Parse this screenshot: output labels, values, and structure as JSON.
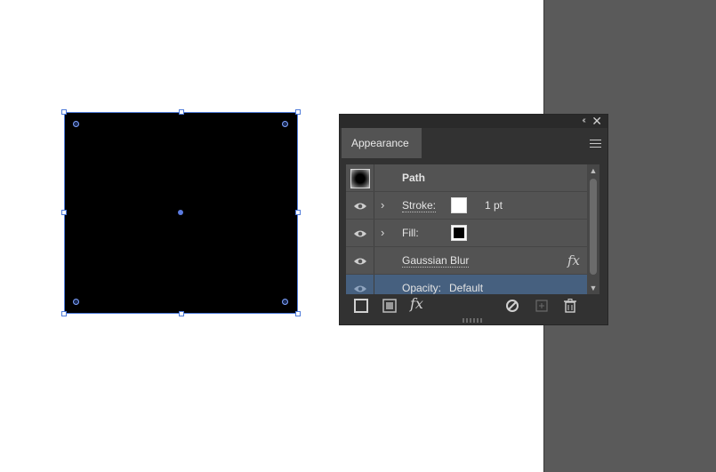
{
  "panel": {
    "tab_label": "Appearance",
    "collapse_glyph": "‹‹",
    "close_glyph": "✕"
  },
  "rows": [
    {
      "label": "Path"
    },
    {
      "label": "Stroke:",
      "value": "1 pt"
    },
    {
      "label": "Fill:"
    },
    {
      "label": "Gaussian Blur",
      "fx": "fx"
    },
    {
      "label": "Opacity:",
      "value": "Default"
    }
  ],
  "footer": {
    "add_effect": "fx"
  },
  "colors": {
    "selection": "#4f7bd9",
    "panel_bg": "#323232",
    "row_bg": "#535353",
    "selected_row": "#46607f",
    "pasteboard": "#5a5a5a"
  },
  "icons": [
    "eye-icon",
    "chevron-right-icon",
    "fx-icon",
    "hamburger-menu-icon",
    "clear-appearance-icon",
    "duplicate-item-icon",
    "trash-icon"
  ]
}
